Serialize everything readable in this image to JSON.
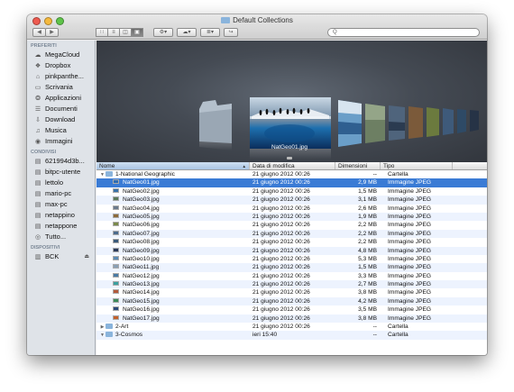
{
  "window": {
    "title": "Default Collections",
    "search_placeholder": "Q",
    "nav_back": "◀",
    "nav_forward": "▶",
    "view_icons": "∷",
    "view_list": "≡",
    "view_columns": "◫",
    "view_coverflow": "▣",
    "action_label": "⚙▾",
    "arrange_label": "☁▾",
    "sort_label": "≣▾",
    "share_label": "↪",
    "colors": {
      "close": "#ee5a4f",
      "minimize": "#f5b93d",
      "zoom": "#5fc44a",
      "selection": "#3a7bd5",
      "folder": "#8ab4dc"
    }
  },
  "sidebar": {
    "sections": [
      {
        "heading": "PREFERITI",
        "items": [
          {
            "label": "MegaCloud",
            "icon": "cloud-drive-icon"
          },
          {
            "label": "Dropbox",
            "icon": "dropbox-icon"
          },
          {
            "label": "pinkpanthe...",
            "icon": "home-icon"
          },
          {
            "label": "Scrivania",
            "icon": "desktop-icon"
          },
          {
            "label": "Applicazioni",
            "icon": "applications-icon"
          },
          {
            "label": "Documenti",
            "icon": "documents-icon"
          },
          {
            "label": "Download",
            "icon": "download-icon"
          },
          {
            "label": "Musica",
            "icon": "music-icon"
          },
          {
            "label": "Immagini",
            "icon": "camera-icon"
          }
        ]
      },
      {
        "heading": "CONDIVISI",
        "items": [
          {
            "label": "621994d3b...",
            "icon": "computer-icon"
          },
          {
            "label": "bitpc-utente",
            "icon": "computer-icon"
          },
          {
            "label": "lettolo",
            "icon": "computer-icon"
          },
          {
            "label": "mario-pc",
            "icon": "computer-icon"
          },
          {
            "label": "max-pc",
            "icon": "computer-icon"
          },
          {
            "label": "netappino",
            "icon": "computer-icon"
          },
          {
            "label": "netappone",
            "icon": "computer-icon"
          },
          {
            "label": "Tutto...",
            "icon": "network-icon"
          }
        ]
      },
      {
        "heading": "DISPOSITIVI",
        "items": [
          {
            "label": "BCK",
            "icon": "disk-icon",
            "eject": "⏏"
          }
        ]
      }
    ]
  },
  "coverflow": {
    "caption": "NatGeo01.jpg"
  },
  "list": {
    "headers": {
      "name": "Nome",
      "date": "Data di modifica",
      "size": "Dimensioni",
      "kind": "Tipo"
    },
    "rows": [
      {
        "name": "1-National Geographic",
        "date": "21 giugno 2012 00:26",
        "size": "--",
        "kind": "Cartella",
        "type": "folder",
        "disclosure": "▼",
        "indent": 0
      },
      {
        "name": "NatGeo01.jpg",
        "date": "21 giugno 2012 00:26",
        "size": "2,9 MB",
        "kind": "Immagine JPEG",
        "type": "jpg",
        "selected": true,
        "indent": 1,
        "thumb": "#2e6db4"
      },
      {
        "name": "NatGeo02.jpg",
        "date": "21 giugno 2012 00:26",
        "size": "1,5 MB",
        "kind": "Immagine JPEG",
        "type": "jpg",
        "indent": 1,
        "thumb": "#3b73a8"
      },
      {
        "name": "NatGeo03.jpg",
        "date": "21 giugno 2012 00:26",
        "size": "3,1 MB",
        "kind": "Immagine JPEG",
        "type": "jpg",
        "indent": 1,
        "thumb": "#5a7a5a"
      },
      {
        "name": "NatGeo04.jpg",
        "date": "21 giugno 2012 00:26",
        "size": "2,6 MB",
        "kind": "Immagine JPEG",
        "type": "jpg",
        "indent": 1,
        "thumb": "#6b7a8c"
      },
      {
        "name": "NatGeo05.jpg",
        "date": "21 giugno 2012 00:26",
        "size": "1,9 MB",
        "kind": "Immagine JPEG",
        "type": "jpg",
        "indent": 1,
        "thumb": "#8c6a3a"
      },
      {
        "name": "NatGeo06.jpg",
        "date": "21 giugno 2012 00:26",
        "size": "2,2 MB",
        "kind": "Immagine JPEG",
        "type": "jpg",
        "indent": 1,
        "thumb": "#7a8a4a"
      },
      {
        "name": "NatGeo07.jpg",
        "date": "21 giugno 2012 00:26",
        "size": "2,2 MB",
        "kind": "Immagine JPEG",
        "type": "jpg",
        "indent": 1,
        "thumb": "#4a6a8c"
      },
      {
        "name": "NatGeo08.jpg",
        "date": "21 giugno 2012 00:26",
        "size": "2,2 MB",
        "kind": "Immagine JPEG",
        "type": "jpg",
        "indent": 1,
        "thumb": "#3a5a7a"
      },
      {
        "name": "NatGeo09.jpg",
        "date": "21 giugno 2012 00:26",
        "size": "4,8 MB",
        "kind": "Immagine JPEG",
        "type": "jpg",
        "indent": 1,
        "thumb": "#2a3a5a"
      },
      {
        "name": "NatGeo10.jpg",
        "date": "21 giugno 2012 00:26",
        "size": "5,3 MB",
        "kind": "Immagine JPEG",
        "type": "jpg",
        "indent": 1,
        "thumb": "#5a8ab4"
      },
      {
        "name": "NatGeo11.jpg",
        "date": "21 giugno 2012 00:26",
        "size": "1,5 MB",
        "kind": "Immagine JPEG",
        "type": "jpg",
        "indent": 1,
        "thumb": "#8aa0b4"
      },
      {
        "name": "NatGeo12.jpg",
        "date": "21 giugno 2012 00:26",
        "size": "3,3 MB",
        "kind": "Immagine JPEG",
        "type": "jpg",
        "indent": 1,
        "thumb": "#4a7aa4"
      },
      {
        "name": "NatGeo13.jpg",
        "date": "21 giugno 2012 00:26",
        "size": "2,7 MB",
        "kind": "Immagine JPEG",
        "type": "jpg",
        "indent": 1,
        "thumb": "#3aa0a0"
      },
      {
        "name": "NatGeo14.jpg",
        "date": "21 giugno 2012 00:26",
        "size": "3,8 MB",
        "kind": "Immagine JPEG",
        "type": "jpg",
        "indent": 1,
        "thumb": "#b45a3a"
      },
      {
        "name": "NatGeo15.jpg",
        "date": "21 giugno 2012 00:26",
        "size": "4,2 MB",
        "kind": "Immagine JPEG",
        "type": "jpg",
        "indent": 1,
        "thumb": "#3a8a5a"
      },
      {
        "name": "NatGeo16.jpg",
        "date": "21 giugno 2012 00:26",
        "size": "3,5 MB",
        "kind": "Immagine JPEG",
        "type": "jpg",
        "indent": 1,
        "thumb": "#2a4a7a"
      },
      {
        "name": "NatGeo17.jpg",
        "date": "21 giugno 2012 00:26",
        "size": "3,8 MB",
        "kind": "Immagine JPEG",
        "type": "jpg",
        "indent": 1,
        "thumb": "#c4602a"
      },
      {
        "name": "2-Art",
        "date": "21 giugno 2012 00:26",
        "size": "--",
        "kind": "Cartella",
        "type": "folder",
        "disclosure": "▶",
        "indent": 0
      },
      {
        "name": "3-Cosmos",
        "date": "ieri 15:40",
        "size": "--",
        "kind": "Cartella",
        "type": "folder",
        "disclosure": "▼",
        "indent": 0
      }
    ]
  }
}
